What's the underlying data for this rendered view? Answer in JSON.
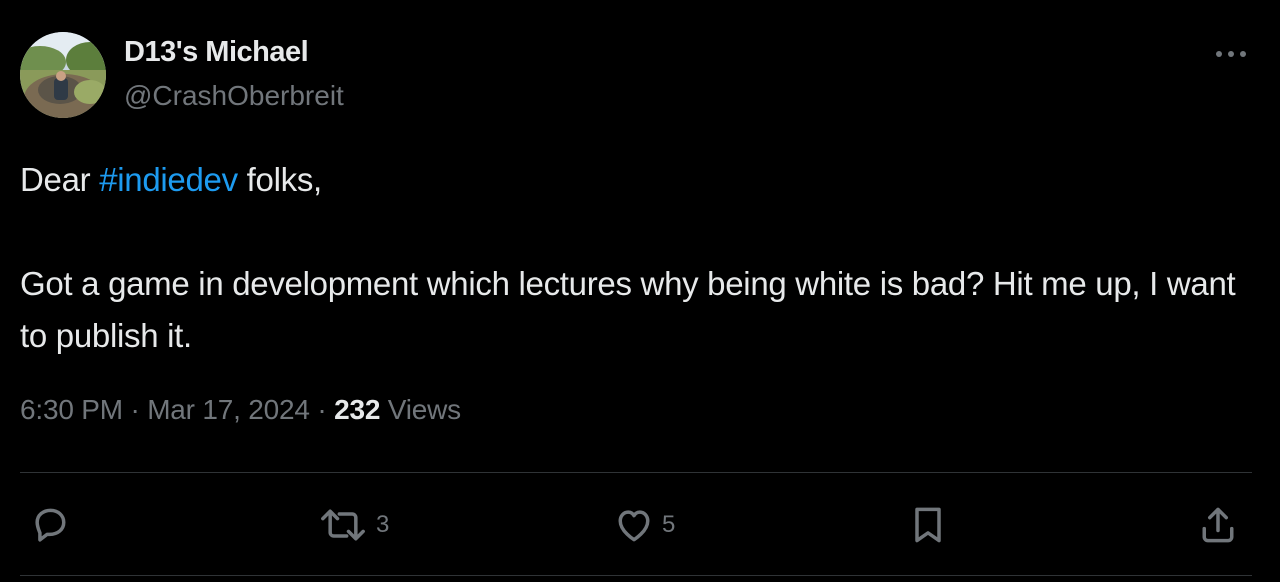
{
  "author": {
    "display_name": "D13's Michael",
    "handle": "@CrashOberbreit"
  },
  "tweet": {
    "text_part1": "Dear ",
    "hashtag": "#indiedev",
    "text_part2": " folks,",
    "text_paragraph2": "Got a game in development which lectures why being white is bad? Hit me up, I want to publish it."
  },
  "meta": {
    "time": "6:30 PM",
    "separator": " · ",
    "date": "Mar 17, 2024",
    "views_count": "232",
    "views_label": " Views"
  },
  "actions": {
    "reply_count": "",
    "repost_count": "3",
    "like_count": "5"
  },
  "icons": {
    "more": "more-horizontal-icon",
    "reply": "speech-bubble-icon",
    "repost": "repost-arrows-icon",
    "like": "heart-icon",
    "bookmark": "bookmark-icon",
    "share": "share-upload-icon"
  },
  "colors": {
    "background": "#000000",
    "text_primary": "#e7e9ea",
    "text_secondary": "#71767b",
    "accent": "#1d9bf0",
    "divider": "#2f3336"
  }
}
